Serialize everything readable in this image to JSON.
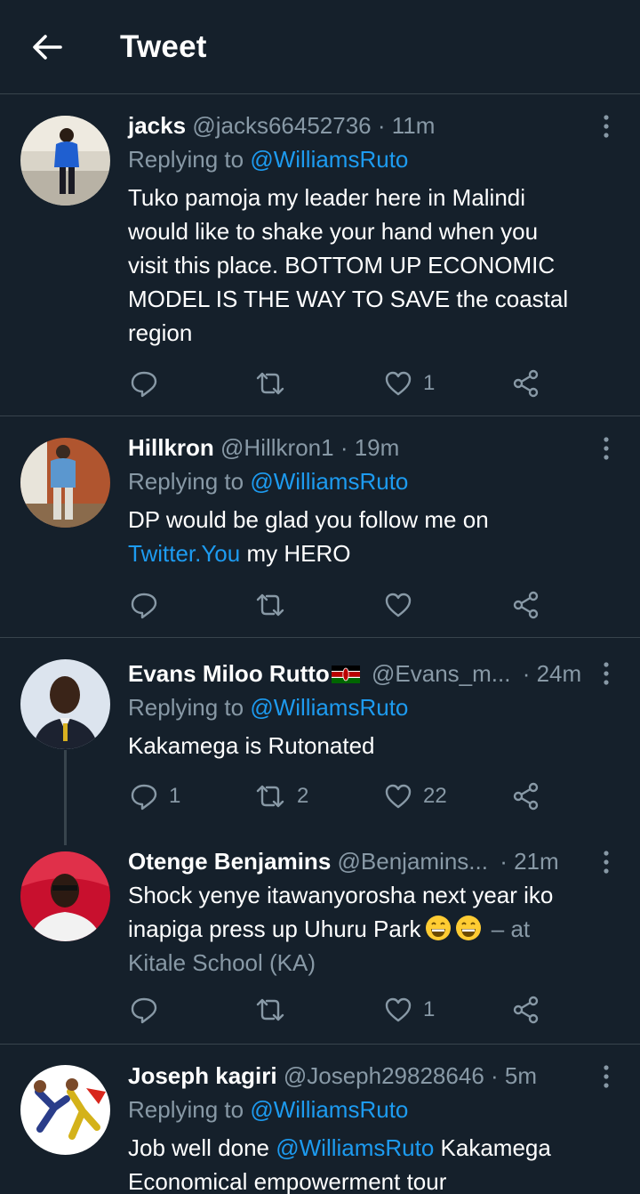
{
  "header": {
    "title": "Tweet"
  },
  "tweets": [
    {
      "name": "jacks",
      "handle": "@jacks66452736",
      "time": "· 11m",
      "replying_prefix": "Replying to",
      "replying_to": "@WilliamsRuto",
      "text_lines": [
        "Tuko pamoja my leader here in Malindi",
        "would like to shake your hand when you",
        "visit this place. BOTTOM UP ECONOMIC",
        "MODEL IS THE WAY TO SAVE the coastal",
        "region"
      ],
      "likes": "1"
    },
    {
      "name": "Hillkron",
      "handle": "@Hillkron1",
      "time": "· 19m",
      "replying_prefix": "Replying to",
      "replying_to": "@WilliamsRuto",
      "text_line1": "DP would be glad you follow me on",
      "text_link": "Twitter.You",
      "text_rest": "my HERO"
    },
    {
      "name": "Evans Miloo Rutto",
      "handle": "@Evans_m...",
      "time": "· 24m",
      "replying_prefix": "Replying to",
      "replying_to": "@WilliamsRuto",
      "text": "Kakamega is Rutonated",
      "replies": "1",
      "retweets": "2",
      "likes": "22"
    },
    {
      "name": "Otenge Benjamins",
      "handle": "@Benjamins...",
      "time": "· 21m",
      "text_line1": "Shock yenye itawanyorosha next year iko",
      "text_line2": "inapiga press up Uhuru Park",
      "text_at": "– at",
      "location": "Kitale School (KA)",
      "likes": "1"
    },
    {
      "name": "Joseph kagiri",
      "handle": "@Joseph29828646",
      "time": "· 5m",
      "replying_prefix": "Replying to",
      "replying_to": "@WilliamsRuto",
      "text_start": "Job well done",
      "text_mention": "@WilliamsRuto",
      "text_end": "Kakamega",
      "text_line2": "Economical empowerment tour"
    }
  ],
  "icons": {
    "back": "arrow-left-icon",
    "more": "more-vertical-icon",
    "reply": "reply-icon",
    "retweet": "retweet-icon",
    "like": "heart-icon",
    "share": "share-icon"
  },
  "colors": {
    "background": "#15202b",
    "link": "#1d9bf0",
    "muted": "#8899a6",
    "divider": "#38444d"
  }
}
